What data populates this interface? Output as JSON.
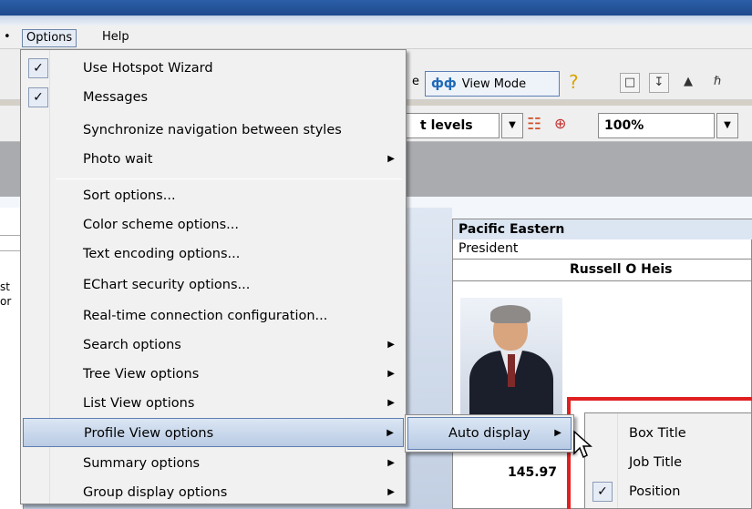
{
  "menubar": {
    "options": "Options",
    "help": "Help"
  },
  "toolbar": {
    "e_fragment": "e",
    "view_mode": "View Mode",
    "levels": "t levels",
    "zoom": "100%"
  },
  "left_edge": {
    "text1": "st",
    "text2": "or"
  },
  "card": {
    "company": "Pacific Eastern",
    "job_title": "President",
    "name": "Russell O Heis",
    "value": "145.97"
  },
  "options_menu": {
    "items": [
      {
        "label": "Use Hotspot Wizard",
        "checked": true
      },
      {
        "label": "Messages",
        "checked": true
      },
      {
        "label": "Synchronize navigation between styles"
      },
      {
        "label": "Photo wait",
        "submenu": true
      },
      {
        "label": "Sort options..."
      },
      {
        "label": "Color scheme options..."
      },
      {
        "label": "Text encoding options..."
      },
      {
        "label": "EChart security options..."
      },
      {
        "label": "Real-time connection configuration..."
      },
      {
        "label": "Search options",
        "submenu": true
      },
      {
        "label": "Tree View options",
        "submenu": true
      },
      {
        "label": "List View options",
        "submenu": true
      },
      {
        "label": "Profile View options",
        "submenu": true,
        "highlighted": true
      },
      {
        "label": "Summary options",
        "submenu": true
      },
      {
        "label": "Group display options",
        "submenu": true
      }
    ]
  },
  "profile_submenu": {
    "items": [
      {
        "label": "Auto display",
        "submenu": true,
        "highlighted": true
      }
    ]
  },
  "auto_display_submenu": {
    "items": [
      {
        "label": "Box Title",
        "checked": false
      },
      {
        "label": "Job Title",
        "checked": false
      },
      {
        "label": "Position",
        "checked": true
      }
    ]
  },
  "colors": {
    "highlight": "#b9cbe4",
    "red_outline": "#e02020",
    "accent_blue": "#2068b8"
  }
}
